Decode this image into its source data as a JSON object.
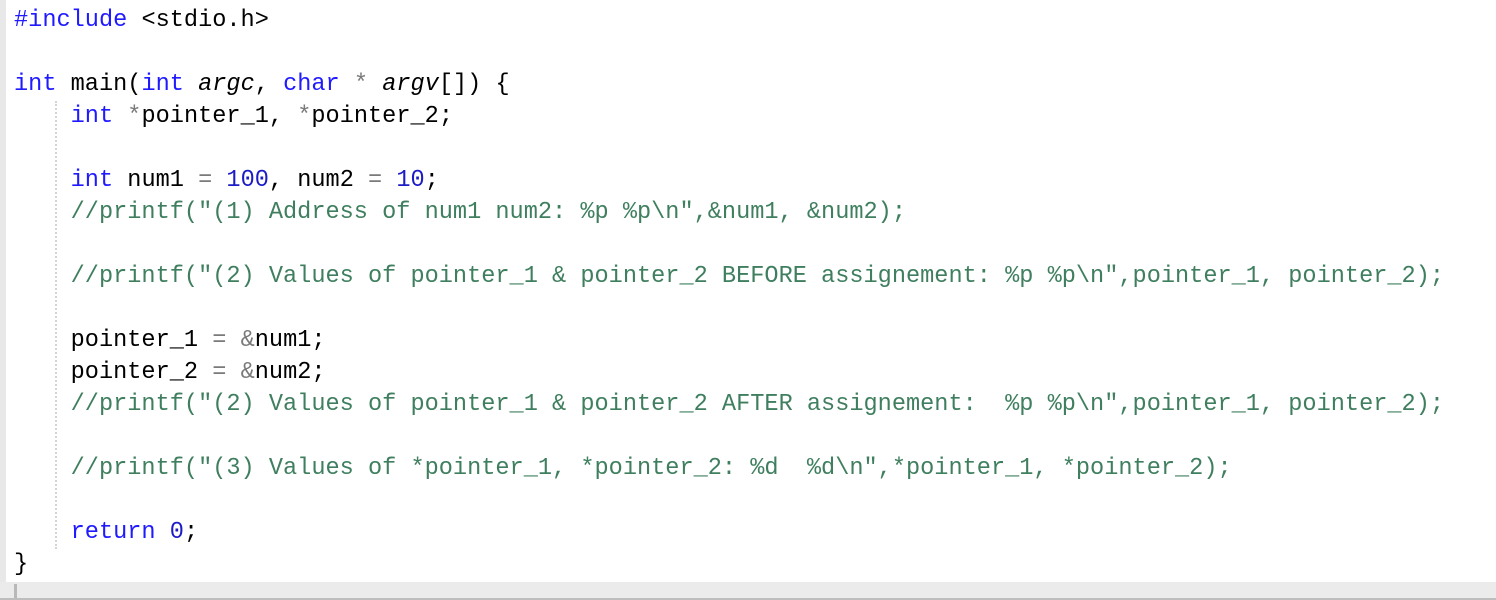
{
  "editor": {
    "language": "c",
    "lines": [
      {
        "tokens": [
          {
            "t": "#include",
            "c": "pp"
          },
          {
            "t": " <stdio.h>",
            "c": ""
          }
        ]
      },
      {
        "tokens": []
      },
      {
        "tokens": [
          {
            "t": "int",
            "c": "kw"
          },
          {
            "t": " main(",
            "c": ""
          },
          {
            "t": "int",
            "c": "kw"
          },
          {
            "t": " ",
            "c": ""
          },
          {
            "t": "argc",
            "c": "it"
          },
          {
            "t": ", ",
            "c": ""
          },
          {
            "t": "char",
            "c": "kw"
          },
          {
            "t": " ",
            "c": ""
          },
          {
            "t": "*",
            "c": "op"
          },
          {
            "t": " ",
            "c": ""
          },
          {
            "t": "argv",
            "c": "it"
          },
          {
            "t": "[]) {",
            "c": ""
          }
        ]
      },
      {
        "tokens": [
          {
            "t": "    ",
            "c": ""
          },
          {
            "t": "int",
            "c": "kw"
          },
          {
            "t": " ",
            "c": ""
          },
          {
            "t": "*",
            "c": "op"
          },
          {
            "t": "pointer_1, ",
            "c": ""
          },
          {
            "t": "*",
            "c": "op"
          },
          {
            "t": "pointer_2;",
            "c": ""
          }
        ]
      },
      {
        "tokens": []
      },
      {
        "tokens": [
          {
            "t": "    ",
            "c": ""
          },
          {
            "t": "int",
            "c": "kw"
          },
          {
            "t": " num1 ",
            "c": ""
          },
          {
            "t": "=",
            "c": "op"
          },
          {
            "t": " ",
            "c": ""
          },
          {
            "t": "100",
            "c": "num"
          },
          {
            "t": ", num2 ",
            "c": ""
          },
          {
            "t": "=",
            "c": "op"
          },
          {
            "t": " ",
            "c": ""
          },
          {
            "t": "10",
            "c": "num"
          },
          {
            "t": ";",
            "c": ""
          }
        ]
      },
      {
        "tokens": [
          {
            "t": "    ",
            "c": ""
          },
          {
            "t": "//printf(\"(1) Address of num1 num2: %p %p\\n\",&num1, &num2);",
            "c": "cm"
          }
        ]
      },
      {
        "tokens": []
      },
      {
        "tokens": [
          {
            "t": "    ",
            "c": ""
          },
          {
            "t": "//printf(\"(2) Values of pointer_1 & pointer_2 BEFORE assignement: %p %p\\n\",pointer_1, pointer_2);",
            "c": "cm"
          }
        ]
      },
      {
        "tokens": []
      },
      {
        "tokens": [
          {
            "t": "    pointer_1 ",
            "c": ""
          },
          {
            "t": "=",
            "c": "op"
          },
          {
            "t": " ",
            "c": ""
          },
          {
            "t": "&",
            "c": "op"
          },
          {
            "t": "num1;",
            "c": ""
          }
        ]
      },
      {
        "tokens": [
          {
            "t": "    pointer_2 ",
            "c": ""
          },
          {
            "t": "=",
            "c": "op"
          },
          {
            "t": " ",
            "c": ""
          },
          {
            "t": "&",
            "c": "op"
          },
          {
            "t": "num2;",
            "c": ""
          }
        ]
      },
      {
        "tokens": [
          {
            "t": "    ",
            "c": ""
          },
          {
            "t": "//printf(\"(2) Values of pointer_1 & pointer_2 AFTER assignement:  %p %p\\n\",pointer_1, pointer_2);",
            "c": "cm"
          }
        ]
      },
      {
        "tokens": []
      },
      {
        "tokens": [
          {
            "t": "    ",
            "c": ""
          },
          {
            "t": "//printf(\"(3) Values of *pointer_1, *pointer_2: %d  %d\\n\",*pointer_1, *pointer_2);",
            "c": "cm"
          }
        ]
      },
      {
        "tokens": []
      },
      {
        "tokens": [
          {
            "t": "    ",
            "c": ""
          },
          {
            "t": "return",
            "c": "kw"
          },
          {
            "t": " ",
            "c": ""
          },
          {
            "t": "0",
            "c": "num"
          },
          {
            "t": ";",
            "c": ""
          }
        ]
      },
      {
        "tokens": [
          {
            "t": "}",
            "c": ""
          }
        ]
      }
    ]
  },
  "colors": {
    "keyword": "#1f1aff",
    "number": "#1c1cc6",
    "comment": "#3f7f5f",
    "operator": "#7a7a7a",
    "text": "#000000",
    "background": "#ffffff"
  }
}
